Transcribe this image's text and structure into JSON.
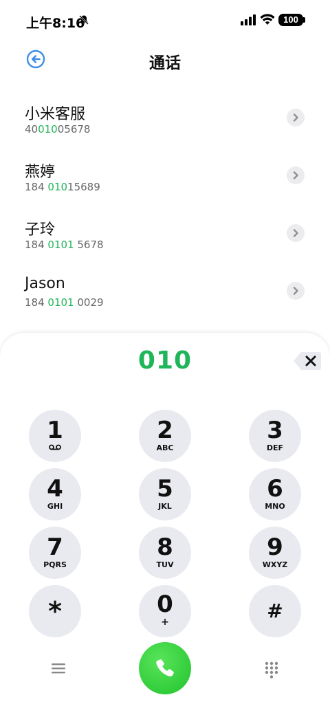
{
  "status_bar": {
    "time": "上午8:16",
    "battery": "100",
    "icons": [
      "mute-bell-icon",
      "signal-icon",
      "wifi-icon",
      "battery-icon"
    ]
  },
  "header": {
    "title": "通话",
    "back_icon": "back-arrow-icon"
  },
  "contacts": [
    {
      "name": "小米客服",
      "number_pre": "40",
      "number_match": "010",
      "number_post": "05678"
    },
    {
      "name": "燕婷",
      "number_pre": "184 ",
      "number_match": "010",
      "number_post": "15689"
    },
    {
      "name": "子玲",
      "number_pre": "184 ",
      "number_match": "0101",
      "number_post": " 5678"
    },
    {
      "name": "Jason",
      "number_pre": "184 ",
      "number_match": "0101",
      "number_post": " 0029"
    }
  ],
  "dialer": {
    "input": "010",
    "keys": [
      {
        "digit": "1",
        "letters": "",
        "sub_icon": "voicemail-icon"
      },
      {
        "digit": "2",
        "letters": "ABC"
      },
      {
        "digit": "3",
        "letters": "DEF"
      },
      {
        "digit": "4",
        "letters": "GHI"
      },
      {
        "digit": "5",
        "letters": "JKL"
      },
      {
        "digit": "6",
        "letters": "MNO"
      },
      {
        "digit": "7",
        "letters": "PQRS"
      },
      {
        "digit": "8",
        "letters": "TUV"
      },
      {
        "digit": "9",
        "letters": "WXYZ"
      },
      {
        "digit": "*",
        "letters": ""
      },
      {
        "digit": "0",
        "letters": "+"
      },
      {
        "digit": "#",
        "letters": ""
      }
    ]
  },
  "bottom_bar": {
    "menu_icon": "menu-icon",
    "call_icon": "phone-icon",
    "keypad_icon": "keypad-icon"
  },
  "colors": {
    "accent_green": "#1fb55a",
    "call_green": "#22c32d",
    "back_blue": "#3a8ee6",
    "key_bg": "#e9e9f0"
  }
}
